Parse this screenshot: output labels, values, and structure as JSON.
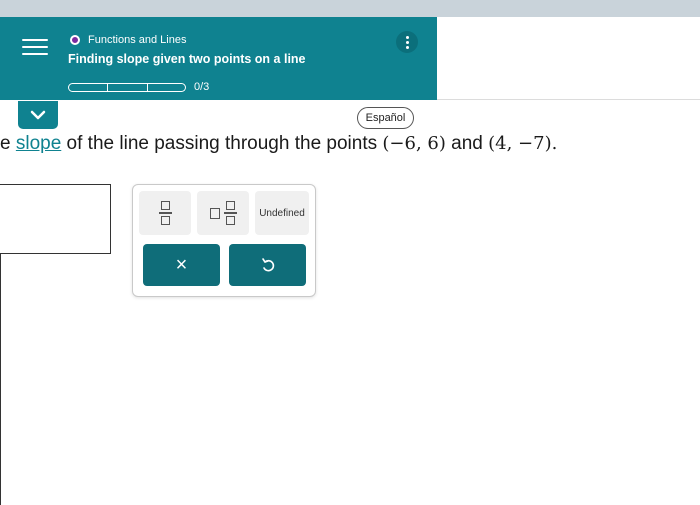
{
  "header": {
    "topic": "Functions and Lines",
    "title": "Finding slope given two points on a line",
    "progress_text": "0/3"
  },
  "toolbar": {
    "language_label": "Español"
  },
  "question": {
    "prefix": "e ",
    "link_text": "slope",
    "middle": " of the line passing through the points ",
    "point1": "(−6, 6)",
    "and": " and ",
    "point2": "(4, −7)",
    "end": "."
  },
  "palette": {
    "undefined_label": "Undefined",
    "clear_symbol": "×"
  },
  "colors": {
    "teal": "#0f8290",
    "dark_teal": "#0f6d79",
    "topic_dot": "#7a2ba0"
  },
  "icons": [
    "menu-icon",
    "kebab-icon",
    "chevron-down-icon",
    "fraction-icon",
    "mixed-number-icon",
    "undo-icon"
  ]
}
